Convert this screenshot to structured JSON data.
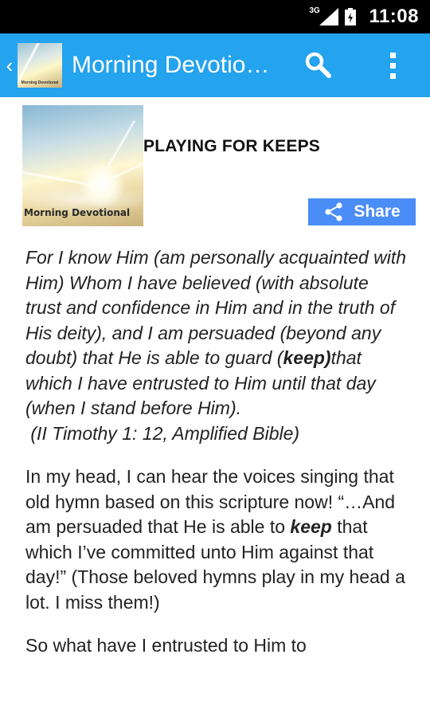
{
  "status_bar": {
    "network": "3G",
    "time": "11:08"
  },
  "app_bar": {
    "title": "Morning Devotio…",
    "icon_caption": "Morning Devotional"
  },
  "article": {
    "title": "PLAYING FOR KEEPS",
    "thumbnail_caption": "Morning Devotional",
    "share_label": "Share",
    "scripture_part1": "For I know Him (am personally acquainted with Him) Whom I have believed (with absolute trust and confidence in Him and in the truth of His deity), and I am persuaded (beyond any doubt) that He is able to guard (",
    "scripture_bold": "keep)",
    "scripture_part2": "that which I have entrusted to Him until that day (when I stand before Him).",
    "scripture_ref": "(II Timothy 1: 12, Amplified Bible)",
    "para1_part1": "In my head, I can hear the voices singing that old hymn based on this scripture now! “…And am persuaded that He is able to ",
    "para1_bold": "keep",
    "para1_part2": " that which I’ve committed unto Him against that day!” (Those beloved hymns play in my head a lot.  I miss them!)",
    "para2": "So what have I entrusted to Him to"
  },
  "colors": {
    "app_bar": "#24a3ee",
    "share_button": "#4a8df6",
    "status_bar": "#000000"
  },
  "icons": {
    "back": "chevron-left-icon",
    "search": "search-icon",
    "more": "more-vert-icon",
    "share": "share-icon"
  }
}
